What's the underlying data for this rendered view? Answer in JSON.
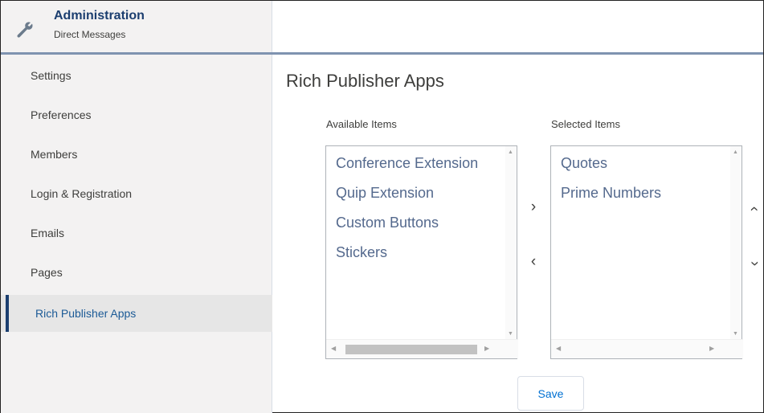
{
  "header": {
    "title": "Administration",
    "subtitle": "Direct Messages",
    "icon": "wrench-icon"
  },
  "sidebar": {
    "items": [
      {
        "label": "Settings"
      },
      {
        "label": "Preferences"
      },
      {
        "label": "Members"
      },
      {
        "label": "Login & Registration"
      },
      {
        "label": "Emails"
      },
      {
        "label": "Pages"
      },
      {
        "label": "Rich Publisher Apps",
        "active": true
      }
    ]
  },
  "main": {
    "title": "Rich Publisher Apps",
    "available": {
      "label": "Available Items",
      "items": [
        "Conference Extension",
        "Quip Extension",
        "Custom Buttons",
        "Stickers"
      ]
    },
    "selected": {
      "label": "Selected Items",
      "items": [
        "Quotes",
        "Prime Numbers"
      ]
    },
    "save_label": "Save"
  },
  "colors": {
    "accent": "#1b3e6f",
    "link": "#0070d2",
    "sidebar_bg": "#f3f2f2",
    "active_item_bg": "#e6e6e6",
    "list_text": "#54698d"
  }
}
